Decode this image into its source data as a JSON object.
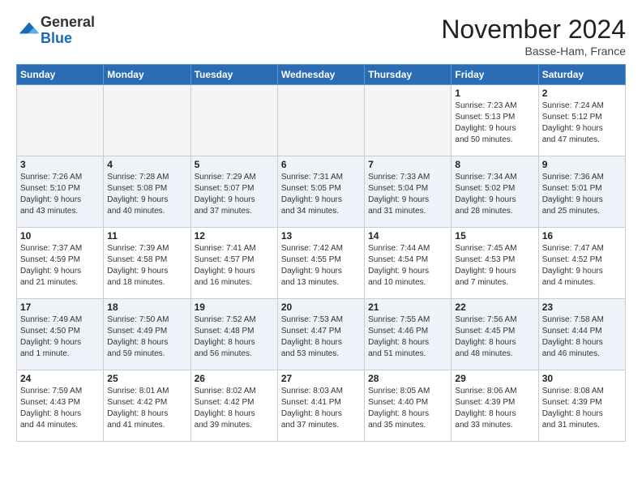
{
  "logo": {
    "general": "General",
    "blue": "Blue"
  },
  "header": {
    "month": "November 2024",
    "location": "Basse-Ham, France"
  },
  "weekdays": [
    "Sunday",
    "Monday",
    "Tuesday",
    "Wednesday",
    "Thursday",
    "Friday",
    "Saturday"
  ],
  "weeks": [
    [
      {
        "day": "",
        "info": ""
      },
      {
        "day": "",
        "info": ""
      },
      {
        "day": "",
        "info": ""
      },
      {
        "day": "",
        "info": ""
      },
      {
        "day": "",
        "info": ""
      },
      {
        "day": "1",
        "info": "Sunrise: 7:23 AM\nSunset: 5:13 PM\nDaylight: 9 hours\nand 50 minutes."
      },
      {
        "day": "2",
        "info": "Sunrise: 7:24 AM\nSunset: 5:12 PM\nDaylight: 9 hours\nand 47 minutes."
      }
    ],
    [
      {
        "day": "3",
        "info": "Sunrise: 7:26 AM\nSunset: 5:10 PM\nDaylight: 9 hours\nand 43 minutes."
      },
      {
        "day": "4",
        "info": "Sunrise: 7:28 AM\nSunset: 5:08 PM\nDaylight: 9 hours\nand 40 minutes."
      },
      {
        "day": "5",
        "info": "Sunrise: 7:29 AM\nSunset: 5:07 PM\nDaylight: 9 hours\nand 37 minutes."
      },
      {
        "day": "6",
        "info": "Sunrise: 7:31 AM\nSunset: 5:05 PM\nDaylight: 9 hours\nand 34 minutes."
      },
      {
        "day": "7",
        "info": "Sunrise: 7:33 AM\nSunset: 5:04 PM\nDaylight: 9 hours\nand 31 minutes."
      },
      {
        "day": "8",
        "info": "Sunrise: 7:34 AM\nSunset: 5:02 PM\nDaylight: 9 hours\nand 28 minutes."
      },
      {
        "day": "9",
        "info": "Sunrise: 7:36 AM\nSunset: 5:01 PM\nDaylight: 9 hours\nand 25 minutes."
      }
    ],
    [
      {
        "day": "10",
        "info": "Sunrise: 7:37 AM\nSunset: 4:59 PM\nDaylight: 9 hours\nand 21 minutes."
      },
      {
        "day": "11",
        "info": "Sunrise: 7:39 AM\nSunset: 4:58 PM\nDaylight: 9 hours\nand 18 minutes."
      },
      {
        "day": "12",
        "info": "Sunrise: 7:41 AM\nSunset: 4:57 PM\nDaylight: 9 hours\nand 16 minutes."
      },
      {
        "day": "13",
        "info": "Sunrise: 7:42 AM\nSunset: 4:55 PM\nDaylight: 9 hours\nand 13 minutes."
      },
      {
        "day": "14",
        "info": "Sunrise: 7:44 AM\nSunset: 4:54 PM\nDaylight: 9 hours\nand 10 minutes."
      },
      {
        "day": "15",
        "info": "Sunrise: 7:45 AM\nSunset: 4:53 PM\nDaylight: 9 hours\nand 7 minutes."
      },
      {
        "day": "16",
        "info": "Sunrise: 7:47 AM\nSunset: 4:52 PM\nDaylight: 9 hours\nand 4 minutes."
      }
    ],
    [
      {
        "day": "17",
        "info": "Sunrise: 7:49 AM\nSunset: 4:50 PM\nDaylight: 9 hours\nand 1 minute."
      },
      {
        "day": "18",
        "info": "Sunrise: 7:50 AM\nSunset: 4:49 PM\nDaylight: 8 hours\nand 59 minutes."
      },
      {
        "day": "19",
        "info": "Sunrise: 7:52 AM\nSunset: 4:48 PM\nDaylight: 8 hours\nand 56 minutes."
      },
      {
        "day": "20",
        "info": "Sunrise: 7:53 AM\nSunset: 4:47 PM\nDaylight: 8 hours\nand 53 minutes."
      },
      {
        "day": "21",
        "info": "Sunrise: 7:55 AM\nSunset: 4:46 PM\nDaylight: 8 hours\nand 51 minutes."
      },
      {
        "day": "22",
        "info": "Sunrise: 7:56 AM\nSunset: 4:45 PM\nDaylight: 8 hours\nand 48 minutes."
      },
      {
        "day": "23",
        "info": "Sunrise: 7:58 AM\nSunset: 4:44 PM\nDaylight: 8 hours\nand 46 minutes."
      }
    ],
    [
      {
        "day": "24",
        "info": "Sunrise: 7:59 AM\nSunset: 4:43 PM\nDaylight: 8 hours\nand 44 minutes."
      },
      {
        "day": "25",
        "info": "Sunrise: 8:01 AM\nSunset: 4:42 PM\nDaylight: 8 hours\nand 41 minutes."
      },
      {
        "day": "26",
        "info": "Sunrise: 8:02 AM\nSunset: 4:42 PM\nDaylight: 8 hours\nand 39 minutes."
      },
      {
        "day": "27",
        "info": "Sunrise: 8:03 AM\nSunset: 4:41 PM\nDaylight: 8 hours\nand 37 minutes."
      },
      {
        "day": "28",
        "info": "Sunrise: 8:05 AM\nSunset: 4:40 PM\nDaylight: 8 hours\nand 35 minutes."
      },
      {
        "day": "29",
        "info": "Sunrise: 8:06 AM\nSunset: 4:39 PM\nDaylight: 8 hours\nand 33 minutes."
      },
      {
        "day": "30",
        "info": "Sunrise: 8:08 AM\nSunset: 4:39 PM\nDaylight: 8 hours\nand 31 minutes."
      }
    ]
  ]
}
